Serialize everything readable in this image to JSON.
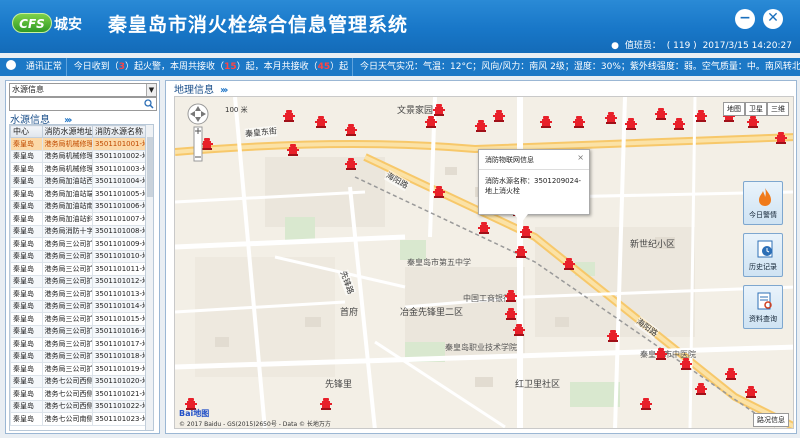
{
  "header": {
    "logo_mark": "CFS",
    "logo_text": "城安",
    "title": "秦皇岛市消火栓综合信息管理系统",
    "minimize_label": "−",
    "close_label": "✕",
    "duty_label": "值班员：",
    "duty_value": "( 119 )",
    "datetime": "2017/3/15 14:20:27"
  },
  "statusbar": {
    "comm": "通讯正常",
    "today_prefix": "今日收到（",
    "today_count": "3",
    "today_suffix": "）起火警，本周共接收（",
    "week_count": "15",
    "week_suffix": "）起，本月共接收（",
    "month_count": "45",
    "month_suffix": "）起",
    "weather": "今日天气实况：气温：12°C；风向/风力：南风 2级；湿度：30%；紫外线强度：弱。空气质量：中。南风转北风微风"
  },
  "left": {
    "select_value": "水源信息",
    "section_title": "水源信息",
    "columns": [
      "中心",
      "消防水源地址",
      "消防水源名称"
    ],
    "rows": [
      [
        "秦皇岛",
        "港务局机械修理分",
        "3501101001-地上消火栓"
      ],
      [
        "秦皇岛",
        "港务局机械修理分",
        "3501101002-地上消火栓"
      ],
      [
        "秦皇岛",
        "港务局机械修理分",
        "3501101003-地上消火栓"
      ],
      [
        "秦皇岛",
        "港务局加油站西侧",
        "3501101004-地上消火栓"
      ],
      [
        "秦皇岛",
        "港务局加油站端面",
        "3501101005-地上消火栓"
      ],
      [
        "秦皇岛",
        "港务局加油站南侧",
        "3501101006-地上消火栓"
      ],
      [
        "秦皇岛",
        "港务局加油站斜十",
        "3501101007-地上消火栓"
      ],
      [
        "秦皇岛",
        "港务局消防十字路",
        "3501101008-地上消火栓"
      ],
      [
        "秦皇岛",
        "港务局三公司扩建",
        "3501101009-地上消火栓"
      ],
      [
        "秦皇岛",
        "港务局三公司扩建",
        "3501101010-地上消火栓"
      ],
      [
        "秦皇岛",
        "港务局三公司扩建",
        "3501101011-地上消火栓"
      ],
      [
        "秦皇岛",
        "港务局三公司扩建",
        "3501101012-地上消火栓"
      ],
      [
        "秦皇岛",
        "港务局三公司扩建",
        "3501101013-地上消火栓"
      ],
      [
        "秦皇岛",
        "港务局三公司扩建",
        "3501101014-地上消火栓"
      ],
      [
        "秦皇岛",
        "港务局三公司扩建",
        "3501101015-地上消火栓"
      ],
      [
        "秦皇岛",
        "港务局三公司扩建",
        "3501101016-地上消火栓"
      ],
      [
        "秦皇岛",
        "港务局三公司扩建",
        "3501101017-地上消火栓"
      ],
      [
        "秦皇岛",
        "港务局三公司扩建",
        "3501101018-地上消火栓"
      ],
      [
        "秦皇岛",
        "港务局三公司扩建",
        "3501101019-地上消火栓"
      ],
      [
        "秦皇岛",
        "港务七公司西侧南",
        "3501101020-地上消火栓"
      ],
      [
        "秦皇岛",
        "港务七公司西侧南",
        "3501101021-地上消火栓"
      ],
      [
        "秦皇岛",
        "港务七公司西侧北",
        "3501101022-地上消火栓"
      ],
      [
        "秦皇岛",
        "港务七公司南侧东",
        "3501101023-地上消火栓"
      ]
    ]
  },
  "right": {
    "section_title": "地理信息",
    "scale": "100 米",
    "map_type_map": "地图",
    "map_type_satellite": "卫星",
    "map_type_3d": "三维",
    "popup_title": "消防物联网信息",
    "popup_body": "消防水源名称：3501209024-地上消火栓",
    "popup_close": "×",
    "tools": [
      "今日警情",
      "历史记录",
      "资料查询"
    ],
    "baidu_logo": "Bai地图",
    "copyright": "© 2017 Baidu - GS(2015)2650号 - Data © 长地万方",
    "traffic": "路况信息",
    "labels": {
      "l1": "文景家园",
      "l2": "秦皇东街",
      "l3": "新世纪小区",
      "l4": "先锋路",
      "l5": "首府",
      "l6": "冶金先锋里二区",
      "l7": "先锋里",
      "l8": "红卫里社区",
      "l9": "海阳路",
      "l10": "中国工商银行",
      "l11": "秦皇岛市第五中学",
      "l12": "秦皇岛职业技术学院",
      "l13": "秦皇岛市中医院",
      "l14": "海阳路"
    }
  },
  "colors": {
    "header": "#1877c8",
    "status_highlight": "#ff4444",
    "selected_row": "#fcd9a8",
    "hydrant": "#e8202a"
  }
}
